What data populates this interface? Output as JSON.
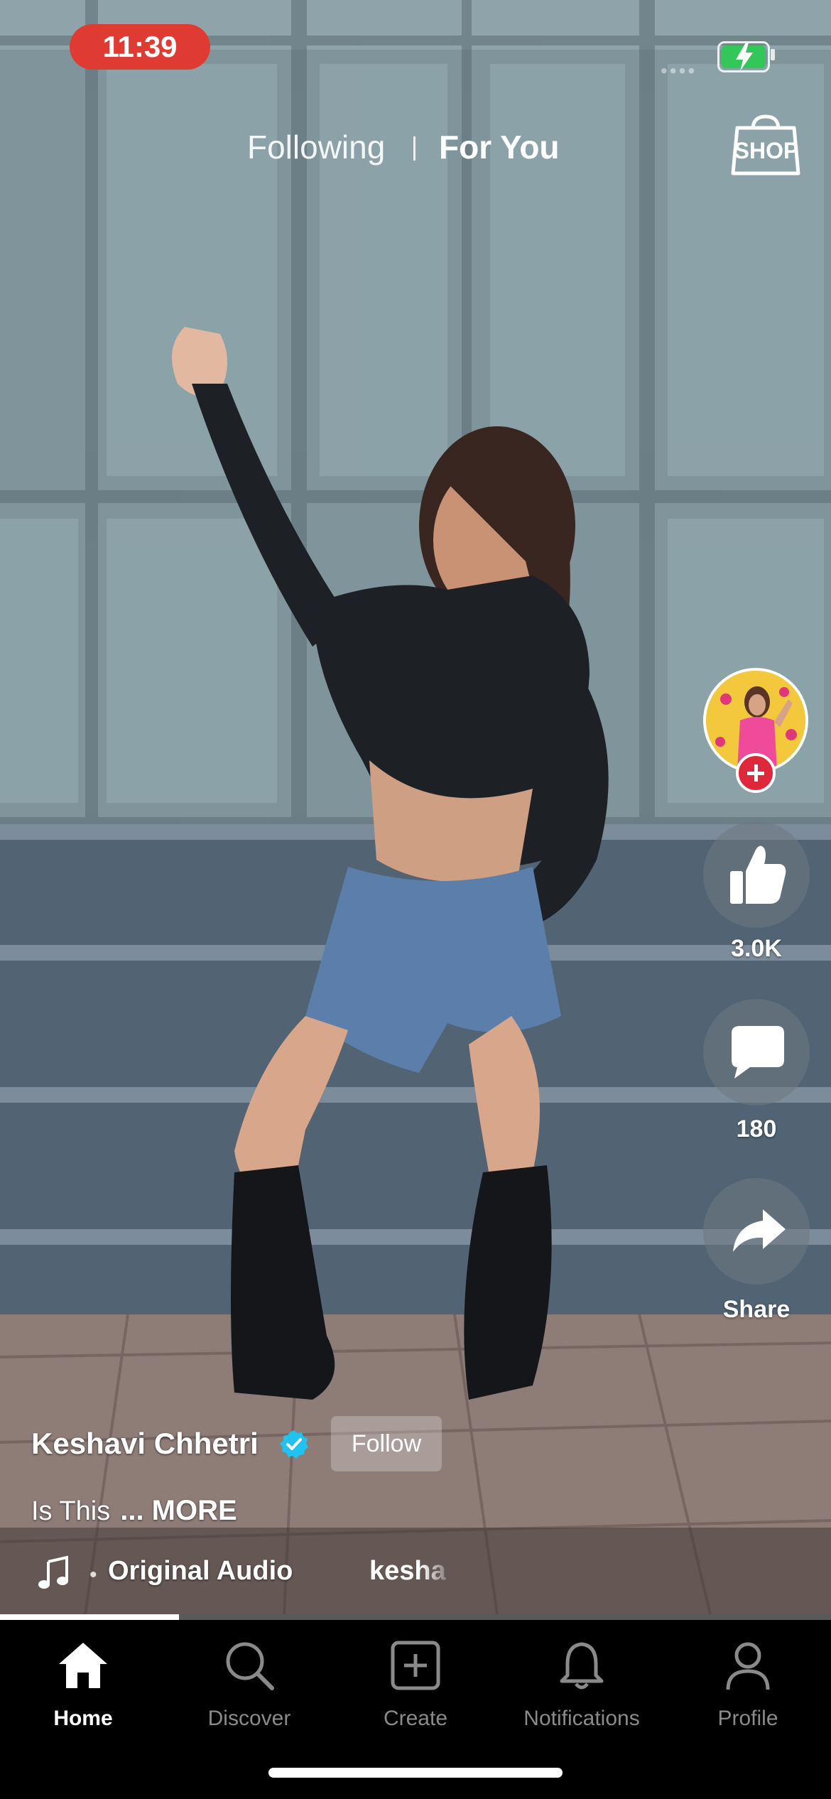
{
  "status_bar": {
    "time": "11:39",
    "battery_level": 1.0,
    "charging": true
  },
  "top_tabs": {
    "following_label": "Following",
    "for_you_label": "For You",
    "active": "For You",
    "shop_label": "SHOP"
  },
  "rail": {
    "like_count": "3.0K",
    "comment_count": "180",
    "share_label": "Share"
  },
  "post": {
    "author": "Keshavi Chhetri",
    "verified": true,
    "follow_label": "Follow",
    "caption_text": "Is This",
    "caption_more": "... MORE",
    "audio_title": "Original Audio",
    "audio_scroll_text": "kesha",
    "progress": 0.215
  },
  "bottom_nav": {
    "items": [
      {
        "label": "Home",
        "icon": "home-icon",
        "active": true
      },
      {
        "label": "Discover",
        "icon": "search-icon",
        "active": false
      },
      {
        "label": "Create",
        "icon": "plus-square-icon",
        "active": false
      },
      {
        "label": "Notifications",
        "icon": "bell-icon",
        "active": false
      },
      {
        "label": "Profile",
        "icon": "person-icon",
        "active": false
      }
    ]
  },
  "colors": {
    "recording_pill": "#e03b33",
    "verified_badge": "#20c3f0",
    "follow_plus_badge": "#e0283d",
    "battery_green": "#33c759"
  }
}
